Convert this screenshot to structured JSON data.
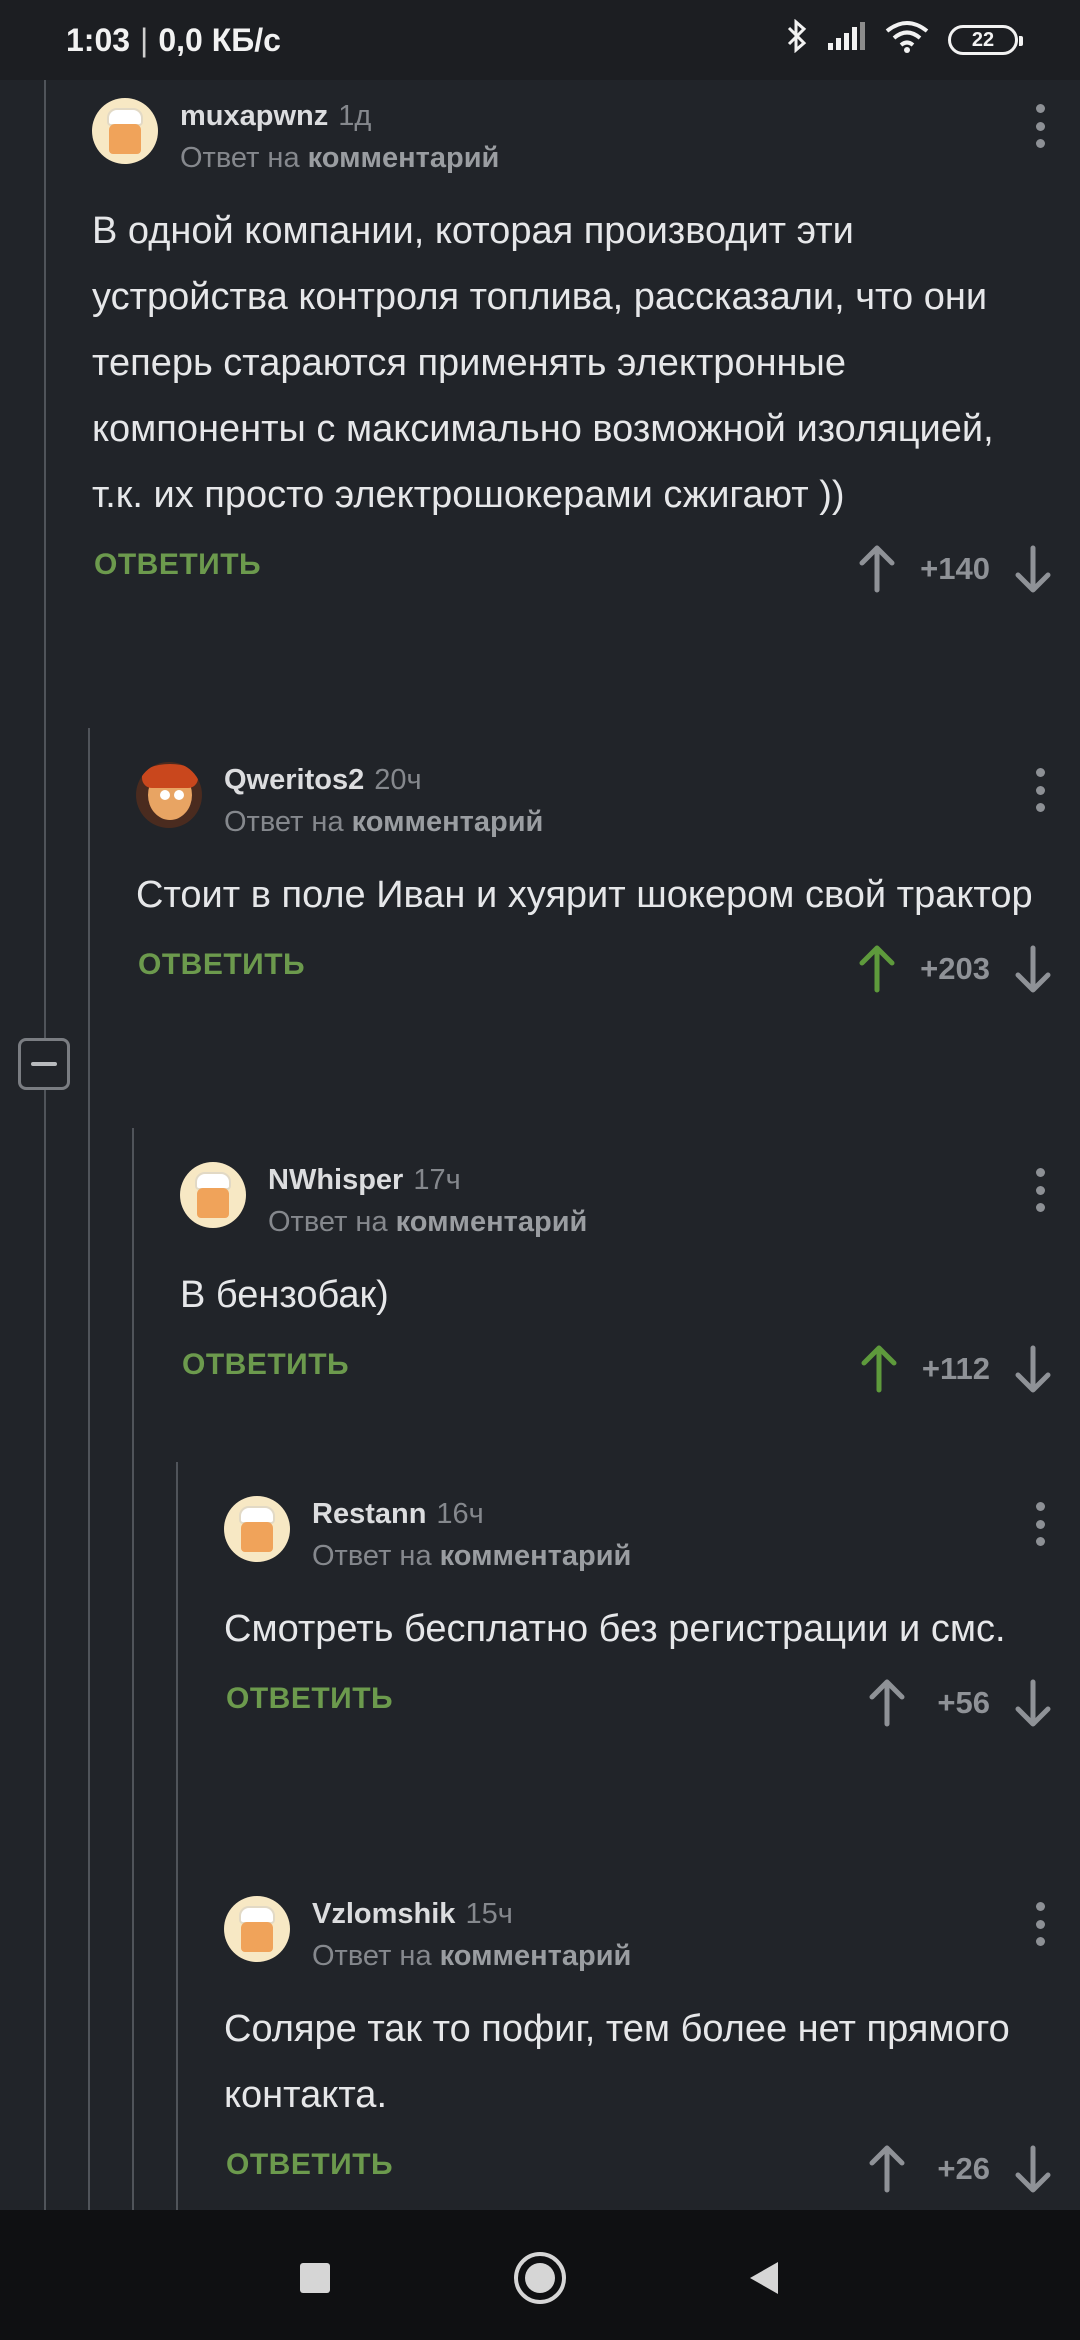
{
  "status_bar": {
    "time": "1:03",
    "speed": "0,0 КБ/с",
    "battery": "22"
  },
  "comments": [
    {
      "username": "muxapwnz",
      "time": "1д",
      "reply_prefix": "Ответ на",
      "reply_target": "комментарий",
      "text": "В одной компании, которая производит эти устройства контроля топлива, рассказали, что они теперь стараются применять электронные компоненты с максимально возможной изоляцией, т.к. их просто электрошокерами сжигают ))",
      "reply_label": "ОТВЕТИТЬ",
      "score": "+140",
      "upvoted": false
    },
    {
      "username": "Qweritos2",
      "time": "20ч",
      "reply_prefix": "Ответ на",
      "reply_target": "комментарий",
      "text": "Стоит в поле Иван и хуярит шокером свой трактор",
      "reply_label": "ОТВЕТИТЬ",
      "score": "+203",
      "upvoted": true
    },
    {
      "username": "NWhisper",
      "time": "17ч",
      "reply_prefix": "Ответ на",
      "reply_target": "комментарий",
      "text": "В бензобак)",
      "reply_label": "ОТВЕТИТЬ",
      "score": "+112",
      "upvoted": true
    },
    {
      "username": "Restann",
      "time": "16ч",
      "reply_prefix": "Ответ на",
      "reply_target": "комментарий",
      "text": "Смотреть бесплатно без регистрации и смс.",
      "reply_label": "ОТВЕТИТЬ",
      "score": "+56",
      "upvoted": false
    },
    {
      "username": "Vzlomshik",
      "time": "15ч",
      "reply_prefix": "Ответ на",
      "reply_target": "комментарий",
      "text": "Соляре так то пофиг, тем более нет прямого контакта.",
      "reply_label": "ОТВЕТИТЬ",
      "score": "+26",
      "upvoted": false
    }
  ],
  "colors": {
    "background": "#212429",
    "accent_green": "#6c9a4d",
    "upvote_active": "#5e9a3c",
    "muted": "#85888d"
  }
}
